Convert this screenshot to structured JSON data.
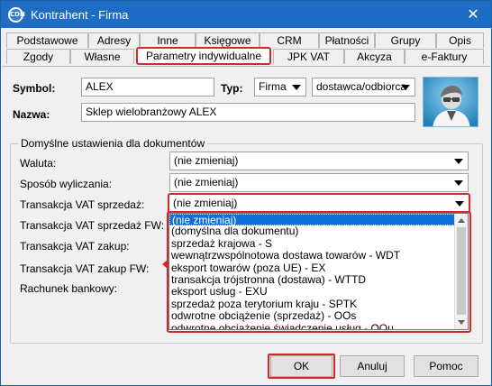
{
  "window": {
    "title": "Kontrahent - Firma",
    "icon_text": "CDN",
    "close_symbol": "✕"
  },
  "tabs_row1": [
    "Podstawowe",
    "Adresy",
    "Inne",
    "Księgowe",
    "CRM",
    "Płatności",
    "Grupy",
    "Opis"
  ],
  "tabs_row2": [
    "Zgody",
    "Własne",
    "Parametry indywidualne",
    "JPK VAT",
    "Akcyza",
    "e-Faktury"
  ],
  "header": {
    "symbol_label": "Symbol:",
    "symbol_value": "ALEX",
    "typ_label": "Typ:",
    "typ_value": "Firma",
    "rola_value": "dostawca/odbiorca",
    "nazwa_label": "Nazwa:",
    "nazwa_value": "Sklep wielobranżowy  ALEX"
  },
  "group": {
    "title": "Domyślne ustawienia dla dokumentów",
    "waluta_label": "Waluta:",
    "waluta_value": "(nie zmieniaj)",
    "sposob_label": "Sposób wyliczania:",
    "sposob_value": "(nie zmieniaj)",
    "vat_sprz_label": "Transakcja VAT sprzedaż:",
    "vat_sprz_value": "(nie zmieniaj)",
    "vat_sprz_fw_label": "Transakcja VAT sprzedaż FW:",
    "vat_zakup_label": "Transakcja VAT zakup:",
    "vat_zakup_fw_label": "Transakcja VAT zakup FW:",
    "rachunek_label": "Rachunek bankowy:"
  },
  "dropdown_options": [
    "(nie zmieniaj)",
    "(domyślna dla dokumentu)",
    "sprzedaż krajowa - S",
    "wewnątrzwspólnotowa dostawa towarów - WDT",
    "eksport towarów (poza UE) - EX",
    "transakcja trójstronna (dostawa) - WTTD",
    "eksport usług - EXU",
    "sprzedaż poza terytorium kraju - SPTK",
    "odwrotne obciążenie (sprzedaż) - OOs",
    "odwrotne obciążenie świadczenie usług - OOu"
  ],
  "buttons": {
    "ok": "OK",
    "cancel": "Anuluj",
    "help": "Pomoc"
  },
  "colors": {
    "titlebar": "#1e6cc5",
    "highlight": "#d9262a",
    "selected_item": "#0f6fd8"
  }
}
